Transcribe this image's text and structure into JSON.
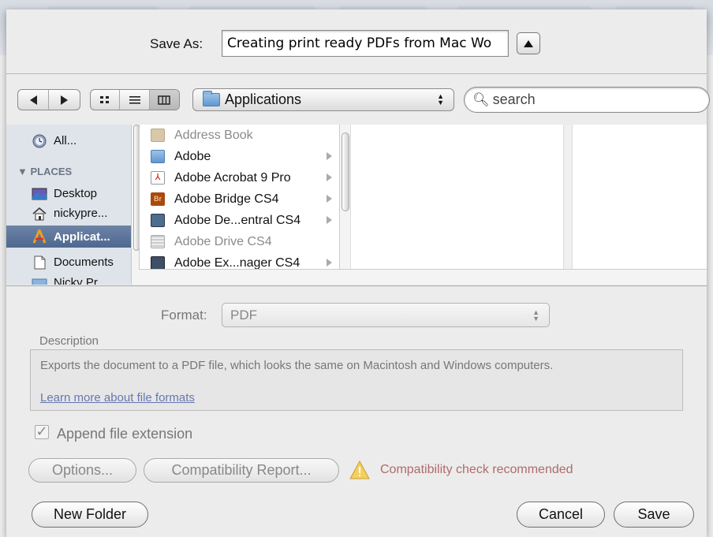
{
  "dialog": {
    "save_as_label": "Save As:",
    "file_name": "Creating print ready PDFs from Mac Wo"
  },
  "toolbar": {
    "location": "Applications",
    "search_placeholder": "search"
  },
  "sidebar": {
    "items_top": [
      {
        "label": "All...",
        "icon": "clock-icon"
      }
    ],
    "places_heading": "PLACES",
    "places": [
      {
        "label": "Desktop",
        "icon": "desktop-icon"
      },
      {
        "label": "nickypre...",
        "icon": "home-icon"
      },
      {
        "label": "Applicat...",
        "icon": "applications-icon",
        "selected": true
      },
      {
        "label": "Documents",
        "icon": "documents-icon"
      },
      {
        "label": "Nicky Pr...",
        "icon": "folder-icon"
      }
    ]
  },
  "browser": {
    "items": [
      {
        "label": "Address Book",
        "dim": true,
        "arrow": false
      },
      {
        "label": "Adobe",
        "dim": false,
        "arrow": true
      },
      {
        "label": "Adobe Acrobat 9 Pro",
        "dim": false,
        "arrow": true
      },
      {
        "label": "Adobe Bridge CS4",
        "dim": false,
        "arrow": true
      },
      {
        "label": "Adobe De...entral CS4",
        "dim": false,
        "arrow": true
      },
      {
        "label": "Adobe Drive CS4",
        "dim": true,
        "arrow": false
      },
      {
        "label": "Adobe Ex...nager CS4",
        "dim": false,
        "arrow": true
      }
    ]
  },
  "format": {
    "label": "Format:",
    "value": "PDF",
    "description_title": "Description",
    "description": "Exports the document to a PDF file, which looks the same on Macintosh and Windows computers.",
    "learn_more": "Learn more about file formats",
    "append_extension": "Append file extension",
    "options_label": "Options...",
    "compat_label": "Compatibility Report...",
    "warning": "Compatibility check recommended"
  },
  "buttons": {
    "new_folder": "New Folder",
    "cancel": "Cancel",
    "save": "Save"
  },
  "colors": {
    "selection": "#5a7399",
    "warning_text": "#b06b6b",
    "link": "#6677b0"
  }
}
